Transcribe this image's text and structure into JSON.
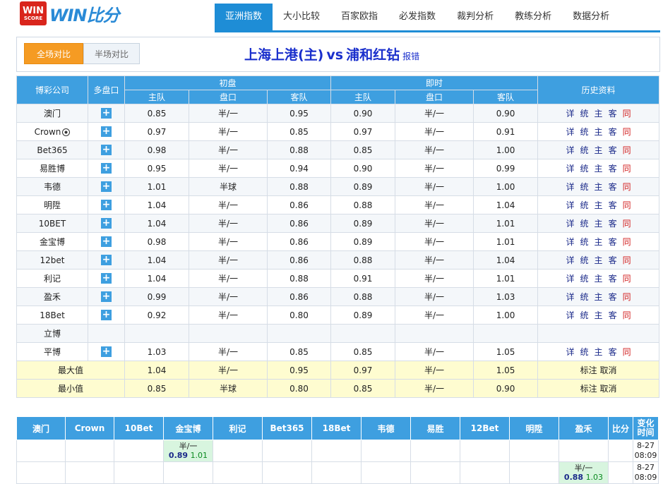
{
  "logo": {
    "badge_top": "WIN",
    "badge_bottom": "SCORE",
    "wordmark": "WIN比分"
  },
  "nav": [
    "亚洲指数",
    "大小比较",
    "百家欧指",
    "必发指数",
    "裁判分析",
    "教练分析",
    "数据分析"
  ],
  "match": {
    "full_btn": "全场对比",
    "half_btn": "半场对比",
    "home": "上海上港(主)",
    "vs": "vs",
    "away": "浦和红钻",
    "report": "报错"
  },
  "table": {
    "col_company": "博彩公司",
    "col_multi": "多盘口",
    "col_initial": "初盘",
    "col_live": "即时",
    "col_history": "历史资料",
    "sub_home": "主队",
    "sub_line": "盘口",
    "sub_away": "客队",
    "plus": "+",
    "hist_links": [
      "详",
      "统",
      "主",
      "客",
      "同"
    ],
    "rows": [
      {
        "company": "澳门",
        "i_home": "0.85",
        "i_line": "半/一",
        "i_away": "0.95",
        "l_home": "0.90",
        "l_line": "半/一",
        "l_away": "0.90"
      },
      {
        "company": "Crown",
        "i_home": "0.97",
        "i_line": "半/一",
        "i_away": "0.85",
        "l_home": "0.97",
        "l_line": "半/一",
        "l_away": "0.91"
      },
      {
        "company": "Bet365",
        "i_home": "0.98",
        "i_line": "半/一",
        "i_away": "0.88",
        "l_home": "0.85",
        "l_line": "半/一",
        "l_away": "1.00"
      },
      {
        "company": "易胜博",
        "i_home": "0.95",
        "i_line": "半/一",
        "i_away": "0.94",
        "l_home": "0.90",
        "l_line": "半/一",
        "l_away": "0.99"
      },
      {
        "company": "韦德",
        "i_home": "1.01",
        "i_line": "半球",
        "i_away": "0.88",
        "l_home": "0.89",
        "l_line": "半/一",
        "l_away": "1.00"
      },
      {
        "company": "明陞",
        "i_home": "1.04",
        "i_line": "半/一",
        "i_away": "0.86",
        "l_home": "0.88",
        "l_line": "半/一",
        "l_away": "1.04"
      },
      {
        "company": "10BET",
        "i_home": "1.04",
        "i_line": "半/一",
        "i_away": "0.86",
        "l_home": "0.89",
        "l_line": "半/一",
        "l_away": "1.01"
      },
      {
        "company": "金宝博",
        "i_home": "0.98",
        "i_line": "半/一",
        "i_away": "0.86",
        "l_home": "0.89",
        "l_line": "半/一",
        "l_away": "1.01"
      },
      {
        "company": "12bet",
        "i_home": "1.04",
        "i_line": "半/一",
        "i_away": "0.86",
        "l_home": "0.88",
        "l_line": "半/一",
        "l_away": "1.04"
      },
      {
        "company": "利记",
        "i_home": "1.04",
        "i_line": "半/一",
        "i_away": "0.88",
        "l_home": "0.91",
        "l_line": "半/一",
        "l_away": "1.01"
      },
      {
        "company": "盈禾",
        "i_home": "0.99",
        "i_line": "半/一",
        "i_away": "0.86",
        "l_home": "0.88",
        "l_line": "半/一",
        "l_away": "1.03"
      },
      {
        "company": "18Bet",
        "i_home": "0.92",
        "i_line": "半/一",
        "i_away": "0.80",
        "l_home": "0.89",
        "l_line": "半/一",
        "l_away": "1.00"
      },
      {
        "company": "立博",
        "empty": true
      },
      {
        "company": "平博",
        "i_home": "1.03",
        "i_line": "半/一",
        "i_away": "0.85",
        "l_home": "0.85",
        "l_line": "半/一",
        "l_away": "1.05"
      }
    ],
    "max": {
      "label": "最大值",
      "i_home": "1.04",
      "i_line": "半/一",
      "i_away": "0.95",
      "l_home": "0.97",
      "l_line": "半/一",
      "l_away": "1.05",
      "action1": "标注",
      "action2": "取消"
    },
    "min": {
      "label": "最小值",
      "i_home": "0.85",
      "i_line": "半球",
      "i_away": "0.80",
      "l_home": "0.85",
      "l_line": "半/一",
      "l_away": "0.90",
      "action1": "标注",
      "action2": "取消"
    }
  },
  "changes": {
    "headers": [
      "澳门",
      "Crown",
      "10Bet",
      "金宝博",
      "利记",
      "Bet365",
      "18Bet",
      "韦德",
      "易胜",
      "12Bet",
      "明陞",
      "盈禾",
      "比分",
      "变化时间"
    ],
    "rows": [
      {
        "col": 3,
        "line": "半/一",
        "home": "0.89",
        "away": "1.01",
        "date": "8-27",
        "time": "08:09"
      },
      {
        "col": 11,
        "line": "半/一",
        "home": "0.88",
        "away": "1.03",
        "date": "8-27",
        "time": "08:09"
      }
    ]
  },
  "colors": {
    "accent": "#3e9fe0",
    "nav_active": "#1e8dd6",
    "orange": "#f59b23",
    "title": "#1a2fcc",
    "summary_bg": "#fefcd0"
  }
}
